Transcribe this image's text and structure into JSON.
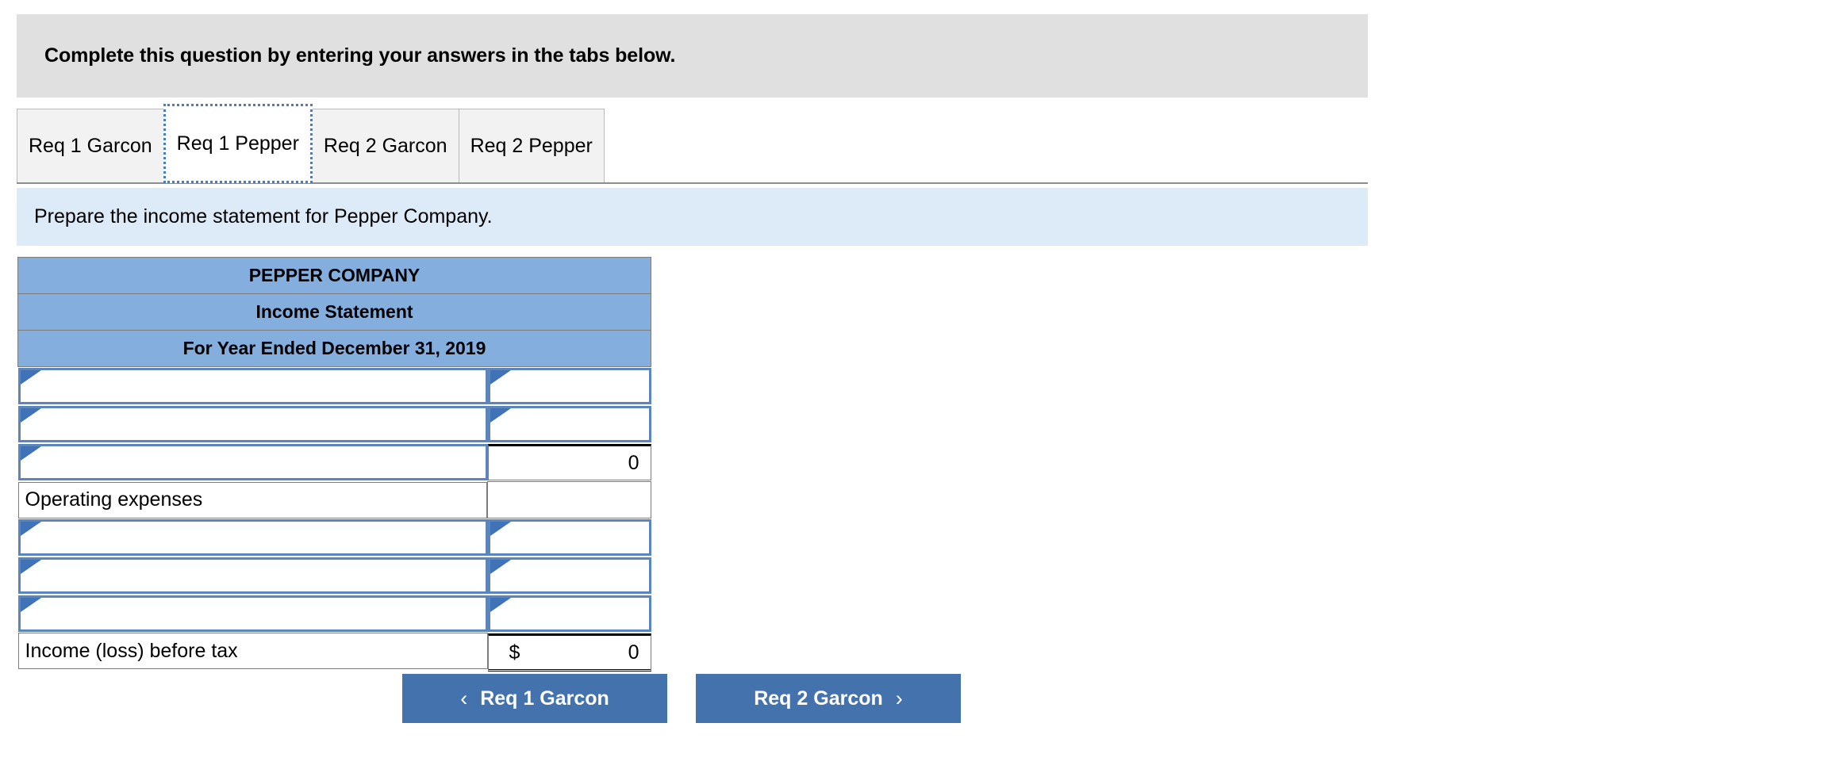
{
  "banner": {
    "text": "Complete this question by entering your answers in the tabs below."
  },
  "tabs": {
    "items": [
      {
        "label": "Req 1 Garcon",
        "active": false
      },
      {
        "label": "Req 1 Pepper",
        "active": true
      },
      {
        "label": "Req 2 Garcon",
        "active": false
      },
      {
        "label": "Req 2 Pepper",
        "active": false
      }
    ]
  },
  "sub_instruction": {
    "text": "Prepare the income statement for Pepper Company."
  },
  "statement": {
    "header_lines": [
      "PEPPER COMPANY",
      "Income Statement",
      "For Year Ended December 31, 2019"
    ],
    "rows": [
      {
        "label": "",
        "label_kind": "input",
        "value": "",
        "value_kind": "input"
      },
      {
        "label": "",
        "label_kind": "input",
        "value": "",
        "value_kind": "input"
      },
      {
        "label": "",
        "label_kind": "input",
        "value": "0",
        "value_kind": "calc"
      },
      {
        "label": "Operating expenses",
        "label_kind": "text",
        "value": "",
        "value_kind": "empty"
      },
      {
        "label": "",
        "label_kind": "input",
        "value": "",
        "value_kind": "input"
      },
      {
        "label": "",
        "label_kind": "input",
        "value": "",
        "value_kind": "input"
      },
      {
        "label": "",
        "label_kind": "input",
        "value": "",
        "value_kind": "input"
      },
      {
        "label": "Income (loss) before tax",
        "label_kind": "text",
        "currency": "$",
        "value": "0",
        "value_kind": "total"
      }
    ]
  },
  "nav": {
    "prev_label": "Req 1 Garcon",
    "prev_icon": "chevron-left",
    "prev_glyph": "‹",
    "next_label": "Req 2 Garcon",
    "next_icon": "chevron-right",
    "next_glyph": "›"
  },
  "colors": {
    "banner_bg": "#e0e0e0",
    "subbar_bg": "#ddeaf7",
    "header_blue": "#84aede",
    "input_border": "#5a86bd",
    "triangle": "#3f72b6",
    "button_blue": "#4472ac",
    "active_tab_focus": "#4a7ebb"
  }
}
